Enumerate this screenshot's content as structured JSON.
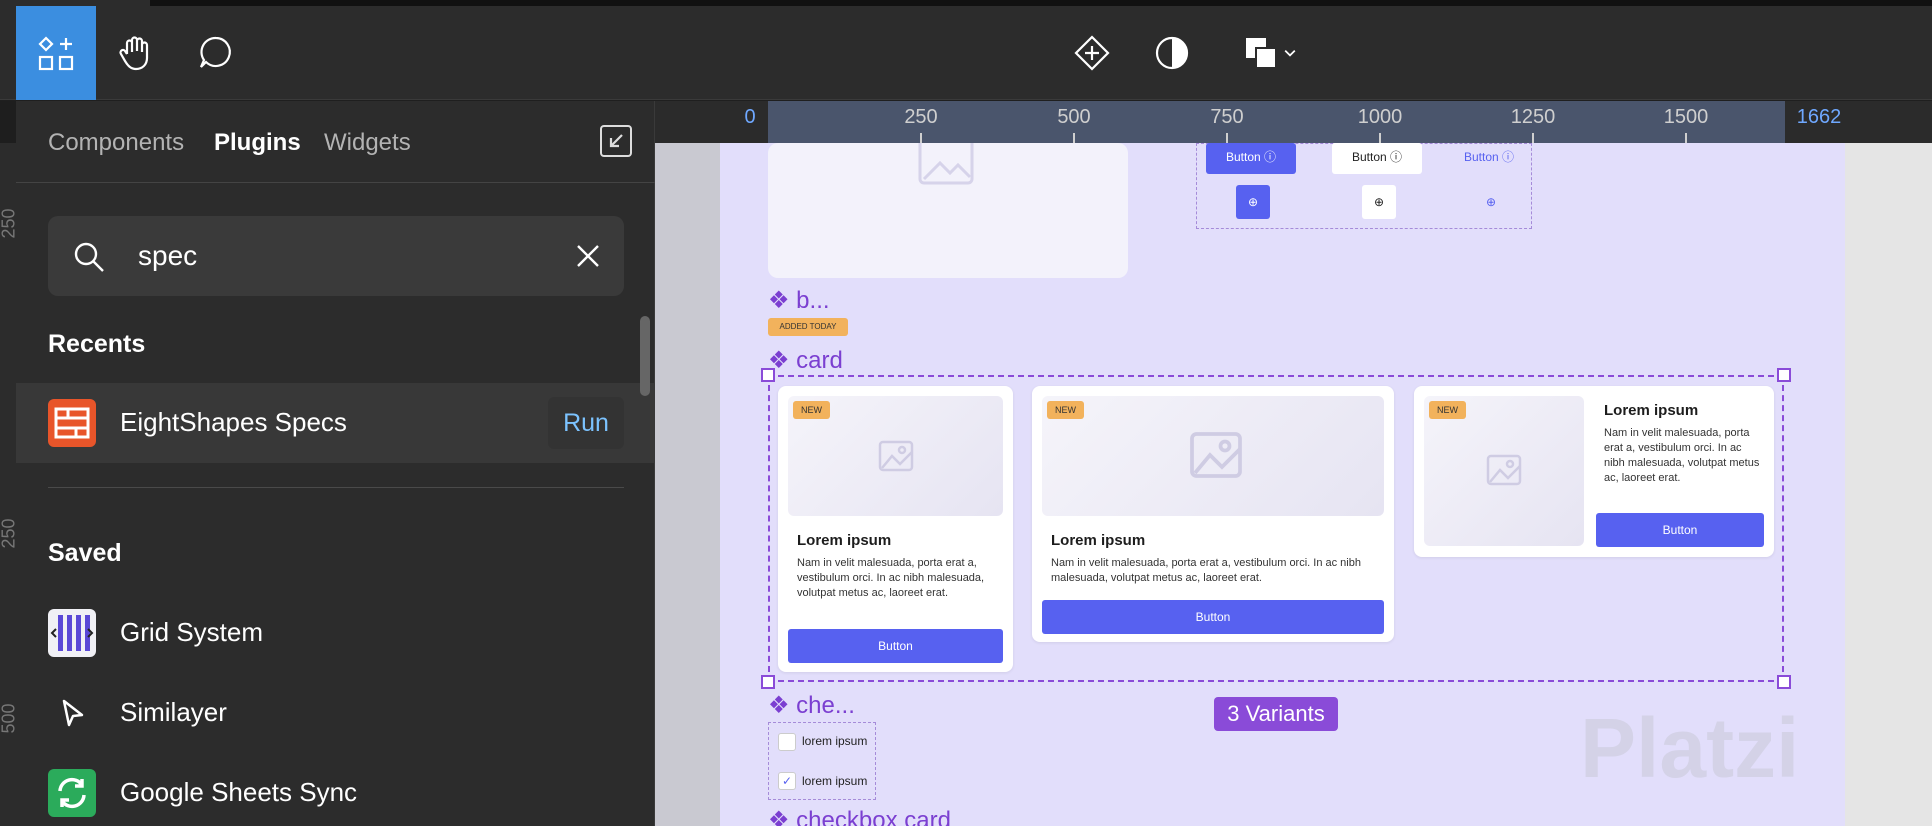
{
  "toolbar": {
    "tools": [
      "Resources",
      "Hand tool",
      "Comment"
    ],
    "center_tools": [
      "Components",
      "Contrast",
      "Fill"
    ]
  },
  "ruler": {
    "labels": [
      "0",
      "250",
      "500",
      "750",
      "1000",
      "1250",
      "1500",
      "1662"
    ]
  },
  "vertical_ruler": [
    "250",
    "250",
    "500"
  ],
  "panel": {
    "tabs": [
      "Components",
      "Plugins",
      "Widgets"
    ],
    "active_tab": "Plugins",
    "search": {
      "value": "spec"
    },
    "recents_heading": "Recents",
    "recents": [
      {
        "name": "EightShapes Specs",
        "action": "Run",
        "icon": "eightshapes-icon",
        "color": "#e8552a"
      }
    ],
    "saved_heading": "Saved",
    "saved": [
      {
        "name": "Grid System",
        "icon": "grid-system-icon"
      },
      {
        "name": "Similayer",
        "icon": "cursor-icon"
      },
      {
        "name": "Google Sheets Sync",
        "icon": "sync-icon",
        "color": "#2bab5b"
      }
    ]
  },
  "canvas": {
    "top_buttons": [
      "Button",
      "Button",
      "Button"
    ],
    "label_b": "❖ b...",
    "added_badge": "ADDED TODAY",
    "label_card": "❖ card",
    "cards": [
      {
        "badge": "NEW",
        "title": "Lorem ipsum",
        "desc": "Nam in velit malesuada, porta erat a, vestibulum orci. In ac nibh malesuada, volutpat metus ac, laoreet erat.",
        "button": "Button"
      },
      {
        "badge": "NEW",
        "title": "Lorem ipsum",
        "desc": "Nam in velit malesuada, porta erat a, vestibulum orci. In ac nibh malesuada, volutpat metus ac, laoreet erat.",
        "button": "Button"
      },
      {
        "badge": "NEW",
        "title": "Lorem ipsum",
        "desc": "Nam in velit malesuada, porta erat a, vestibulum orci. In ac nibh malesuada, volutpat metus ac, laoreet erat.",
        "button": "Button"
      }
    ],
    "variants_label": "3 Variants",
    "label_che": "❖ che...",
    "checkbox_labels": [
      "lorem ipsum",
      "lorem ipsum"
    ],
    "label_checkbox_card": "❖ checkbox card",
    "watermark": "Platzi"
  },
  "colors": {
    "accent": "#5761f0",
    "selection": "#8a4bd8",
    "badge": "#f2b25c",
    "frame_bg": "#e2defb"
  }
}
